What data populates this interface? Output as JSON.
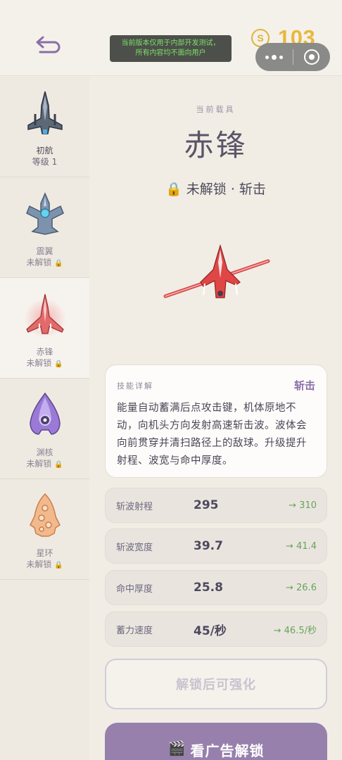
{
  "header": {
    "notice_line1": "当前版本仅用于内部开发测试，",
    "notice_line2": "所有内容均不面向用户",
    "coin_symbol": "S",
    "coins": "103"
  },
  "sidebar": {
    "items": [
      {
        "name": "初航",
        "status": "等级 1",
        "locked": false,
        "active": false,
        "icon": "jet-fighter-gray-icon"
      },
      {
        "name": "震翼",
        "status": "未解锁",
        "locked": true,
        "active": false,
        "icon": "jet-fighter-blue-icon"
      },
      {
        "name": "赤锋",
        "status": "未解锁",
        "locked": true,
        "active": true,
        "icon": "jet-fighter-red-icon"
      },
      {
        "name": "渊核",
        "status": "未解锁",
        "locked": true,
        "active": false,
        "icon": "core-ship-purple-icon"
      },
      {
        "name": "星环",
        "status": "未解锁",
        "locked": true,
        "active": false,
        "icon": "ring-ship-orange-icon"
      }
    ],
    "lock_glyph": "🔒"
  },
  "main": {
    "subtitle": "当前载具",
    "title": "赤锋",
    "lock_line": "🔒 未解锁 · 斩击",
    "skill": {
      "label": "技能详解",
      "name": "斩击",
      "description": "能量自动蓄满后点攻击键，机体原地不动，向机头方向发射高速斩击波。波体会向前贯穿并清扫路径上的敌球。升级提升射程、波宽与命中厚度。"
    },
    "stats": [
      {
        "label": "斩波射程",
        "value": "295",
        "next": "→ 310"
      },
      {
        "label": "斩波宽度",
        "value": "39.7",
        "next": "→ 41.4"
      },
      {
        "label": "命中厚度",
        "value": "25.8",
        "next": "→ 26.6"
      },
      {
        "label": "蓄力速度",
        "value": "45/秒",
        "next": "→ 46.5/秒"
      }
    ],
    "enhance_label": "解锁后可强化",
    "ad_icon": "🎬",
    "ad_label": "看广告解锁"
  },
  "colors": {
    "accent": "#9880ad",
    "coin": "#e9b83b",
    "upgrade_green": "#6aa35d",
    "notice_text": "#7be06a"
  }
}
